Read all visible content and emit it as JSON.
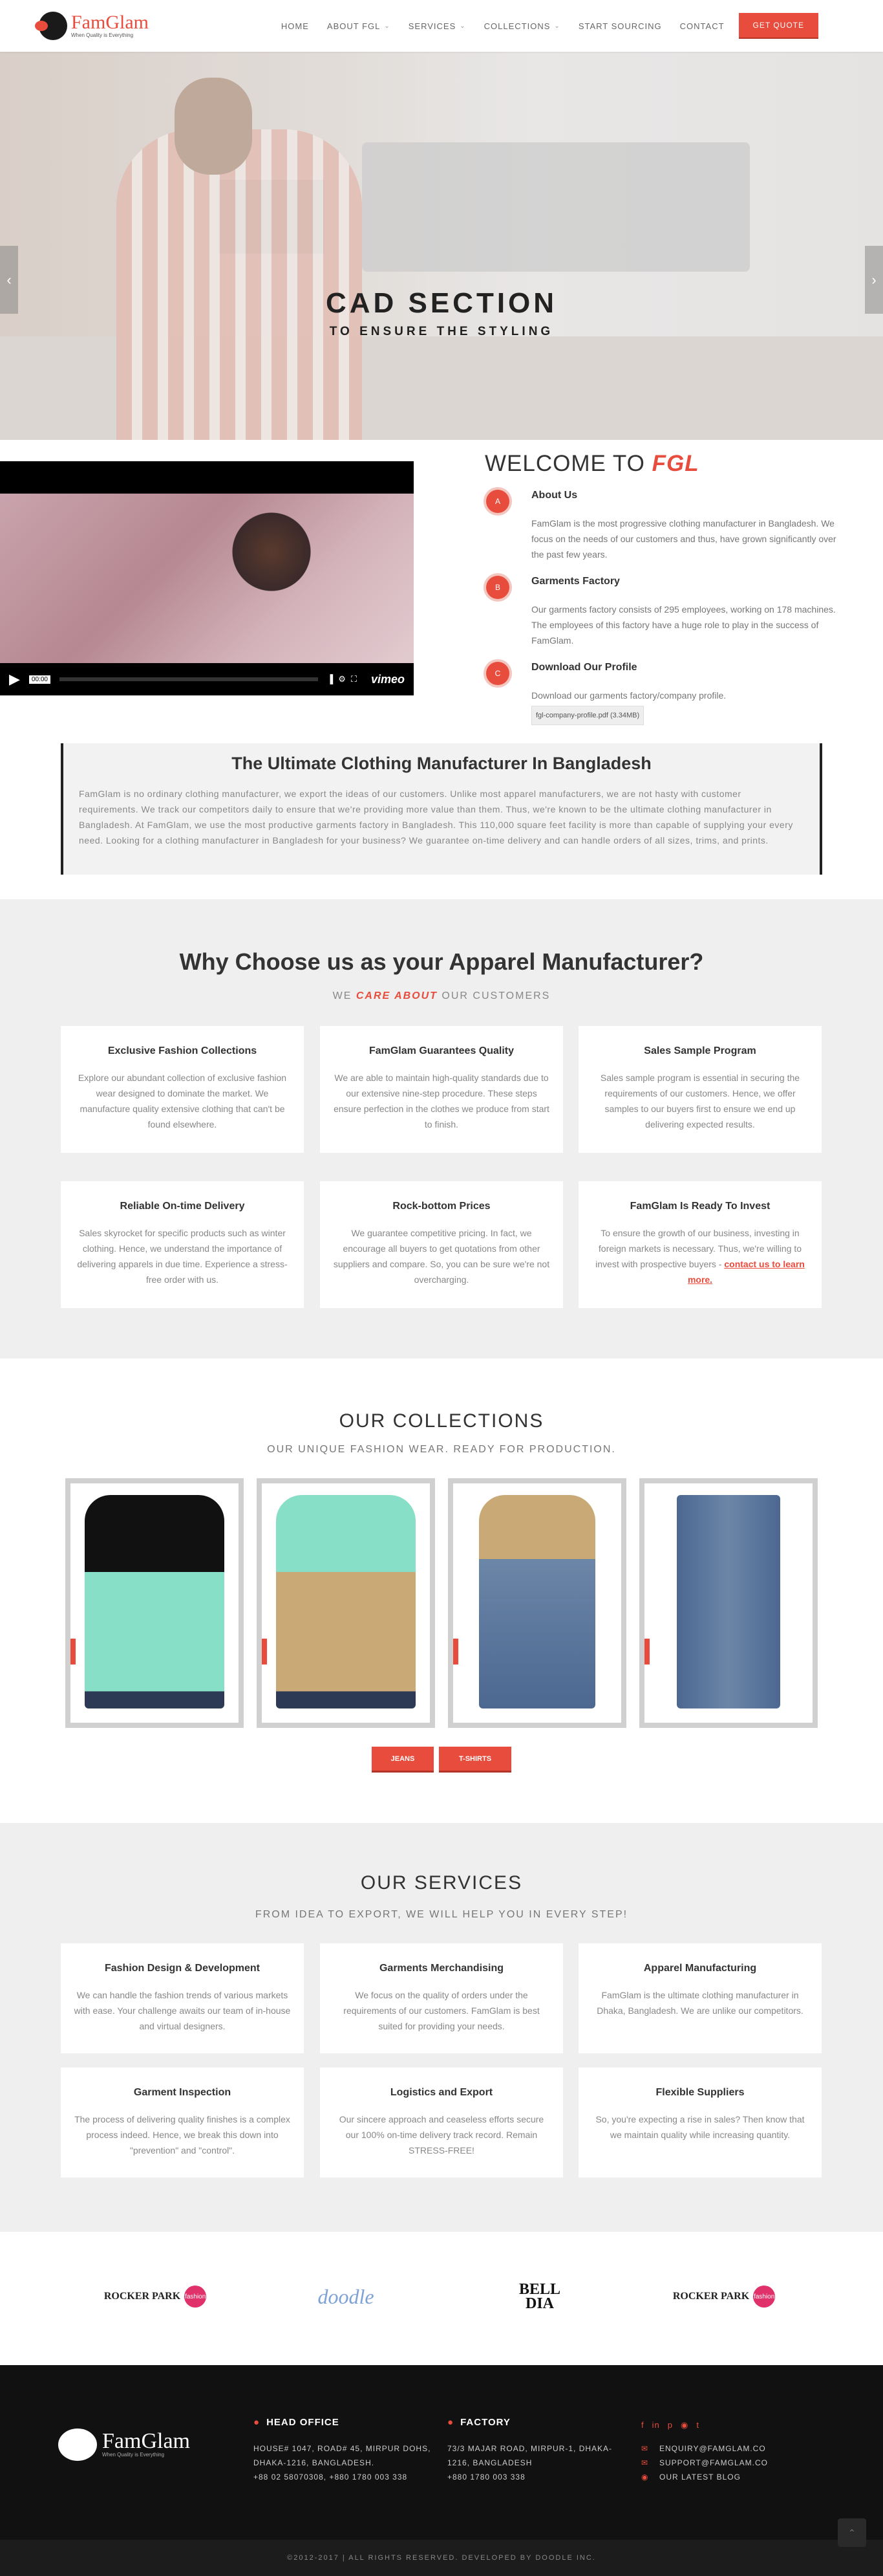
{
  "header": {
    "logo_text": "FamGlam",
    "logo_tagline": "When Quality is Everything",
    "nav": [
      {
        "label": "HOME",
        "dropdown": false
      },
      {
        "label": "ABOUT FGL",
        "dropdown": true
      },
      {
        "label": "SERVICES",
        "dropdown": true
      },
      {
        "label": "COLLECTIONS",
        "dropdown": true
      },
      {
        "label": "START SOURCING",
        "dropdown": false
      },
      {
        "label": "CONTACT",
        "dropdown": false
      }
    ],
    "quote_label": "GET QUOTE"
  },
  "hero": {
    "title": "CAD SECTION",
    "subtitle": "TO ENSURE THE STYLING"
  },
  "video": {
    "time": "00:00",
    "logo": "vimeo"
  },
  "welcome": {
    "title_prefix": "WELCOME TO",
    "title_brand": "FGL",
    "items": [
      {
        "badge": "A",
        "title": "About Us",
        "text": "FamGlam is the most progressive clothing manufacturer in Bangladesh. We focus on the needs of our customers and thus, have grown significantly over the past few years."
      },
      {
        "badge": "B",
        "title": "Garments Factory",
        "text": "Our garments factory consists of 295 employees, working on 178 machines. The employees of this factory have a huge role to play in the success of FamGlam."
      },
      {
        "badge": "C",
        "title": "Download Our Profile",
        "text": "Download our garments factory/company profile.",
        "file": "fgl-company-profile.pdf (3.34MB)"
      }
    ]
  },
  "callout": {
    "title": "The Ultimate Clothing Manufacturer In Bangladesh",
    "text": "FamGlam is no ordinary clothing manufacturer, we export the ideas of our customers. Unlike most apparel manufacturers, we are not hasty with customer requirements. We track our competitors daily to ensure that we're providing more value than them. Thus, we're known to be the ultimate clothing manufacturer in Bangladesh. At FamGlam, we use the most productive garments factory in Bangladesh. This 110,000 square feet facility is more than capable of supplying your every need. Looking for a clothing manufacturer in Bangladesh for your business? We guarantee on-time delivery and can handle orders of all sizes, trims, and prints."
  },
  "why": {
    "title": "Why Choose us as your Apparel Manufacturer?",
    "sub_prefix": "WE",
    "sub_em": "CARE ABOUT",
    "sub_suffix": "OUR CUSTOMERS",
    "cards": [
      {
        "title": "Exclusive Fashion Collections",
        "text": "Explore our abundant collection of exclusive fashion wear designed to dominate the market. We manufacture quality extensive clothing that can't be found elsewhere."
      },
      {
        "title": "FamGlam Guarantees Quality",
        "text": "We are able to maintain high-quality standards due to our extensive nine-step procedure. These steps ensure perfection in the clothes we produce from start to finish."
      },
      {
        "title": "Sales Sample Program",
        "text": "Sales sample program is essential in securing the requirements of our customers. Hence, we offer samples to our buyers first to ensure we end up delivering expected results."
      },
      {
        "title": "Reliable On-time Delivery",
        "text": "Sales skyrocket for specific products such as winter clothing. Hence, we understand the importance of delivering apparels in due time. Experience a stress-free order with us."
      },
      {
        "title": "Rock-bottom Prices",
        "text": "We guarantee competitive pricing. In fact, we encourage all buyers to get quotations from other suppliers and compare. So, you can be sure we're not overcharging."
      },
      {
        "title": "FamGlam Is Ready To Invest",
        "text": "To ensure the growth of our business, investing in foreign markets is necessary. Thus, we're willing to invest with prospective buyers -",
        "link": "contact us to learn more."
      }
    ]
  },
  "collections": {
    "title": "OUR COLLECTIONS",
    "subtitle": "OUR UNIQUE FASHION WEAR. READY FOR PRODUCTION.",
    "buttons": [
      "JEANS",
      "T-SHIRTS"
    ]
  },
  "services": {
    "title": "OUR SERVICES",
    "subtitle": "FROM IDEA TO EXPORT, WE WILL HELP YOU IN EVERY STEP!",
    "cards": [
      {
        "title": "Fashion Design & Development",
        "text": "We can handle the fashion trends of various markets with ease. Your challenge awaits our team of in-house and virtual designers."
      },
      {
        "title": "Garments Merchandising",
        "text": "We focus on the quality of orders under the requirements of our customers. FamGlam is best suited for providing your needs."
      },
      {
        "title": "Apparel Manufacturing",
        "text": "FamGlam is the ultimate clothing manufacturer in Dhaka, Bangladesh. We are unlike our competitors."
      },
      {
        "title": "Garment Inspection",
        "text": "The process of delivering quality finishes is a complex process indeed. Hence, we break this down into \"prevention\" and \"control\"."
      },
      {
        "title": "Logistics and Export",
        "text": "Our sincere approach and ceaseless efforts secure our 100% on-time delivery track record. Remain STRESS-FREE!"
      },
      {
        "title": "Flexible Suppliers",
        "text": "So, you're expecting a rise in sales? Then know that we maintain quality while increasing quantity."
      }
    ]
  },
  "partners": [
    {
      "name": "ROCKER PARK",
      "tag": "fashion"
    },
    {
      "name": "doodle",
      "tag": ""
    },
    {
      "name": "BELL DIA",
      "tag": ""
    },
    {
      "name": "ROCKER PARK",
      "tag": "fashion"
    }
  ],
  "footer": {
    "head_office": {
      "title": "HEAD OFFICE",
      "lines": [
        "HOUSE# 1047, ROAD# 45, MIRPUR DOHS,",
        "DHAKA-1216, BANGLADESH.",
        "+88 02 58070308, +880 1780 003 338"
      ]
    },
    "factory": {
      "title": "FACTORY",
      "lines": [
        "73/3 MAJAR ROAD, MIRPUR-1, DHAKA-",
        "1216, BANGLADESH",
        "+880 1780 003 338"
      ]
    },
    "contact": [
      {
        "icon": "mail-icon",
        "text": "ENQUIRY@FAMGLAM.CO"
      },
      {
        "icon": "mail-icon",
        "text": "SUPPORT@FAMGLAM.CO"
      },
      {
        "icon": "camera-icon",
        "text": "OUR LATEST BLOG"
      }
    ],
    "copyright": "©2012-2017 | ALL RIGHTS RESERVED. DEVELOPED BY DOODLE INC."
  },
  "colors": {
    "accent": "#e74c3c",
    "dark": "#111111",
    "panel": "#efefef"
  }
}
